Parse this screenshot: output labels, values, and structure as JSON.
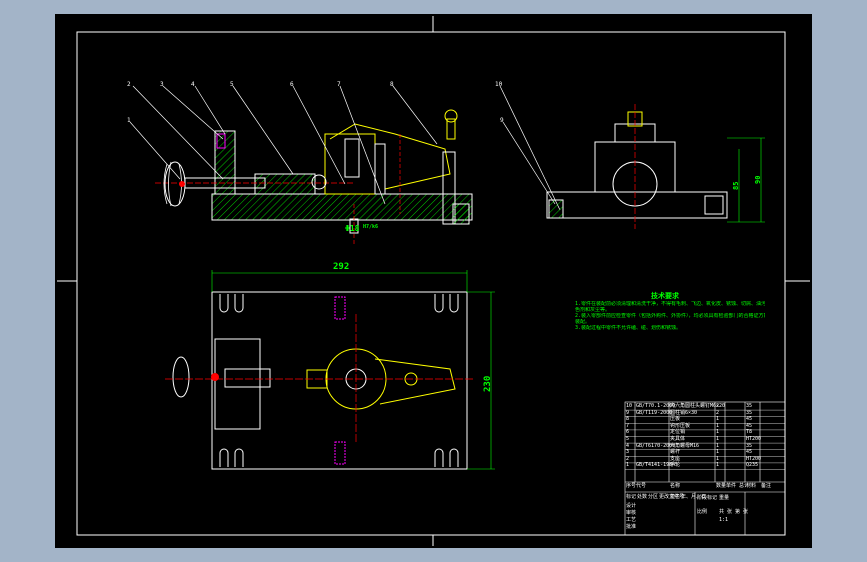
{
  "drawing": {
    "colors": {
      "background": "#000000",
      "outline": "#ffffff",
      "hatch": "#00ff00",
      "dimension": "#00ff00",
      "part": "#ffff00",
      "center": "#ff0000",
      "accent": "#ff00ff"
    },
    "balloons": [
      "1",
      "2",
      "3",
      "4",
      "5",
      "6",
      "7",
      "8",
      "9",
      "10"
    ],
    "dimensions": {
      "width": "292",
      "height": "230",
      "dia": "Φ18",
      "dia_fit": "H7/k6",
      "h1": "85",
      "h2": "90"
    },
    "tech_title": "技术要求",
    "tech_notes": [
      "1.零件在装配前必须清理和清洗干净，不得有毛刺、飞边、氧化皮、锈蚀、切屑、油污、着",
      "  色剂和灰尘等。",
      "2.装入零部件前应检查零件（包括外购件、外协件），均必须具有检验部门的合格证方能进行",
      "  装配。",
      "3.装配过程中零件不允许磕、碰、划伤和锈蚀。"
    ],
    "title_block": {
      "rows": [
        [
          "10",
          "GB/T70.1-2000",
          "内六角圆柱头螺钉M6×20",
          "2",
          "",
          "35"
        ],
        [
          "9",
          "GB/T119-2000",
          "圆柱销6×30",
          "2",
          "",
          "35"
        ],
        [
          "8",
          "",
          "压板",
          "1",
          "",
          "45"
        ],
        [
          "7",
          "",
          "钩形压板",
          "1",
          "",
          "45"
        ],
        [
          "6",
          "",
          "定位销",
          "1",
          "",
          "T8"
        ],
        [
          "5",
          "",
          "夹具体",
          "1",
          "",
          "HT200"
        ],
        [
          "4",
          "GB/T6170-2000",
          "六角螺母M16",
          "1",
          "",
          "35"
        ],
        [
          "3",
          "",
          "螺杆",
          "1",
          "",
          "45"
        ],
        [
          "2",
          "",
          "支座",
          "1",
          "",
          "HT200"
        ],
        [
          "1",
          "GB/T4141-1984",
          "手轮",
          "1",
          "",
          "Q235"
        ]
      ],
      "header": [
        "序号",
        "代号",
        "名称",
        "数量",
        "单件 总计",
        "材料",
        "备注"
      ],
      "footer_left": [
        "标记",
        "处数",
        "分区",
        "更改文件号",
        "签名",
        "年、月、日"
      ],
      "footer_roles": [
        "设计",
        "审核",
        "工艺",
        "批准"
      ],
      "footer_right": [
        "阶段标记",
        "重量",
        "比例",
        "共 张 第 张"
      ],
      "scale": "1:1"
    }
  }
}
